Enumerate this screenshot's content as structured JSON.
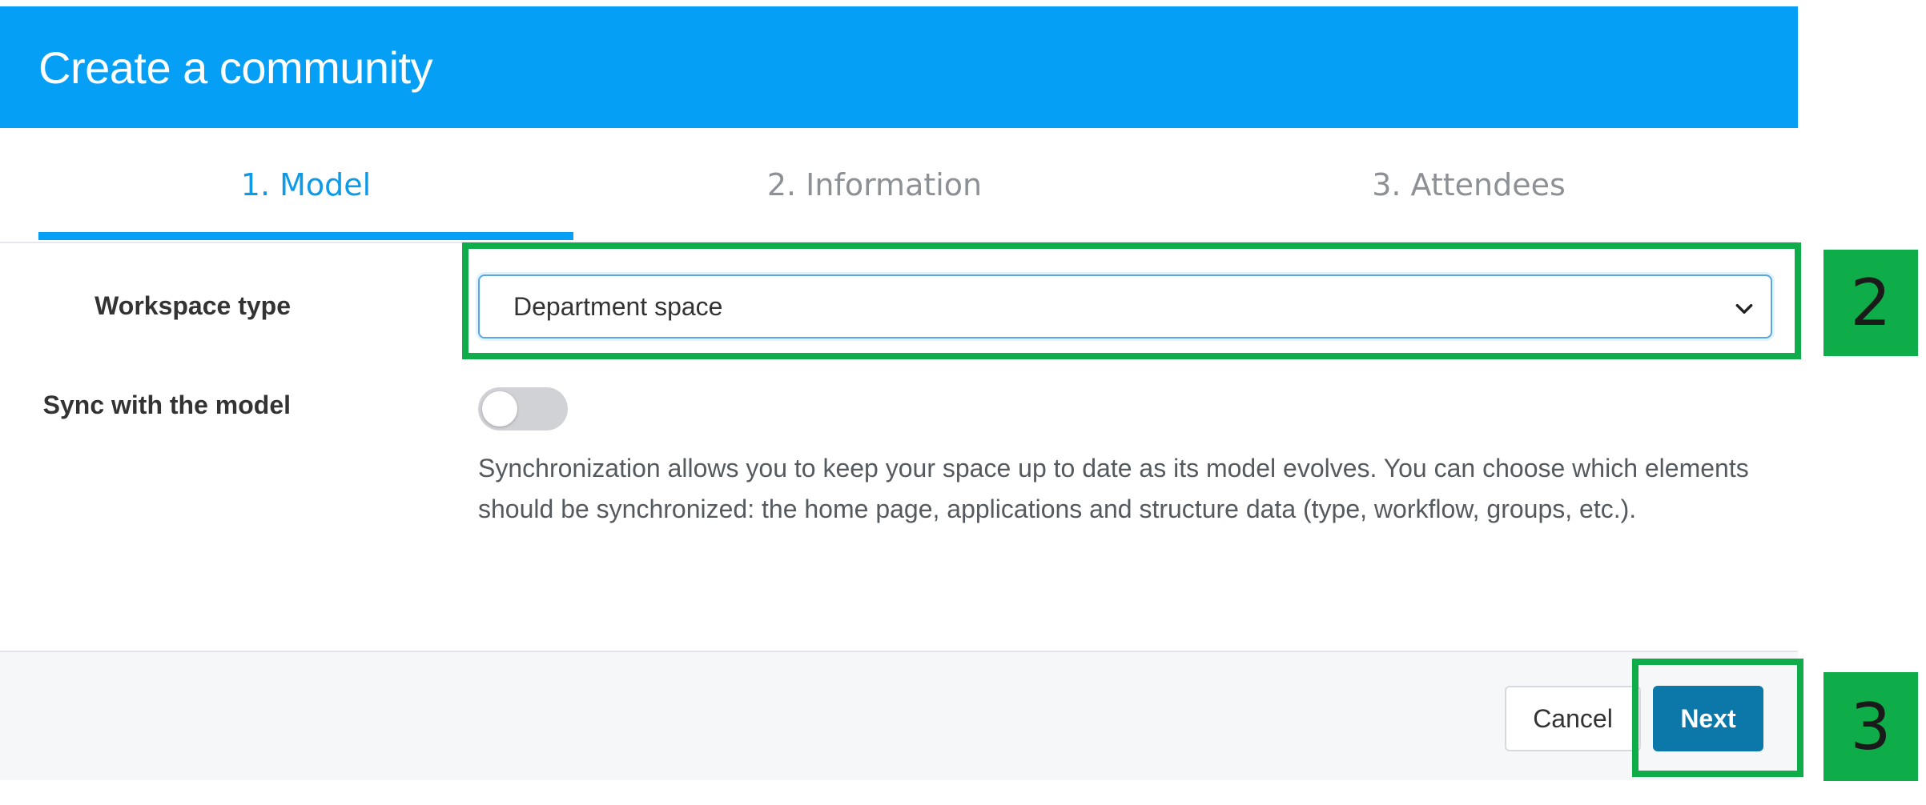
{
  "modal": {
    "title": "Create a community",
    "tabs": [
      {
        "label": "1. Model",
        "active": true
      },
      {
        "label": "2. Information",
        "active": false
      },
      {
        "label": "3. Attendees",
        "active": false
      }
    ]
  },
  "form": {
    "workspace_type": {
      "label": "Workspace type",
      "selected": "Department space"
    },
    "sync": {
      "label": "Sync with the model",
      "enabled": false,
      "help": "Synchronization allows you to keep your space up to date as its model evolves. You can choose which elements should be synchronized: the home page, applications and structure data (type, workflow, groups, etc.)."
    }
  },
  "footer": {
    "cancel_label": "Cancel",
    "next_label": "Next"
  },
  "annotations": {
    "step_2": "2",
    "step_3": "3"
  },
  "colors": {
    "header": "#05a0f5",
    "active_tab": "#0d9be8",
    "next_button": "#0b78a9",
    "highlight": "#0fad4a"
  },
  "icons": {
    "select_chevron": "chevron-down-icon"
  }
}
